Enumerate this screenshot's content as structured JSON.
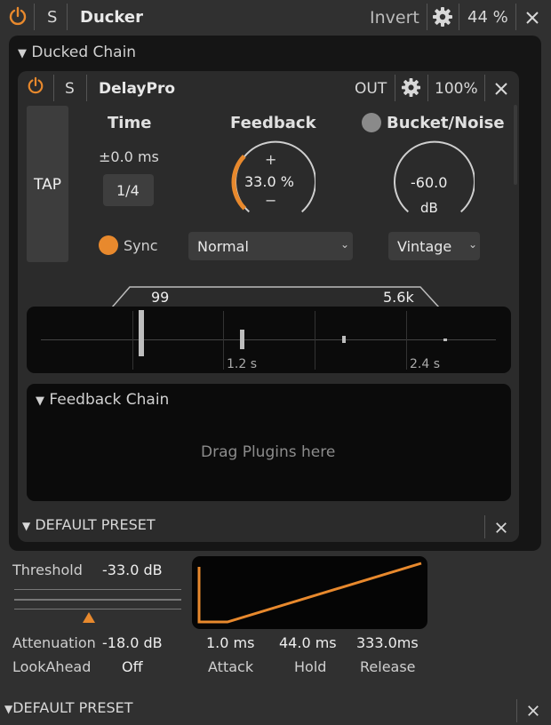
{
  "header": {
    "power_icon": "power-icon",
    "solo_label": "S",
    "title": "Ducker",
    "invert_label": "Invert",
    "settings_icon": "gear-icon",
    "mix_value": "44 %",
    "close_icon": "close-icon"
  },
  "ducked_chain": {
    "title": "Ducked Chain",
    "plugin": {
      "power_icon": "power-icon",
      "solo_label": "S",
      "name": "DelayPro",
      "out_label": "OUT",
      "settings_icon": "gear-icon",
      "mix_value": "100%",
      "close_icon": "close-icon",
      "tap_label": "TAP",
      "time": {
        "title": "Time",
        "offset_value": "±0.0 ms",
        "note_value": "1/4",
        "sync_label": "Sync"
      },
      "feedback": {
        "title": "Feedback",
        "plus": "+",
        "value": "33.0 %",
        "minus": "−",
        "level": 0.33,
        "mode_value": "Normal"
      },
      "bucket": {
        "title": "Bucket/Noise",
        "value": "-60.0",
        "unit": "dB",
        "mode_value": "Vintage"
      },
      "filter": {
        "low_value": "99",
        "high_value": "5.6k"
      },
      "taps": {
        "label_1": "1.2 s",
        "label_2": "2.4 s"
      },
      "feedback_chain": {
        "title": "Feedback Chain",
        "placeholder": "Drag Plugins here"
      },
      "preset_label": "DEFAULT PRESET"
    }
  },
  "dynamics": {
    "threshold_label": "Threshold",
    "threshold_value": "-33.0 dB",
    "attenuation_label": "Attenuation",
    "attenuation_value": "-18.0 dB",
    "lookahead_label": "LookAhead",
    "lookahead_value": "Off",
    "attack_value": "1.0 ms",
    "attack_label": "Attack",
    "hold_value": "44.0 ms",
    "hold_label": "Hold",
    "release_value": "333.0ms",
    "release_label": "Release"
  },
  "footer": {
    "preset_label": "DEFAULT PRESET"
  },
  "colors": {
    "accent": "#e8892d",
    "background": "#303030"
  }
}
